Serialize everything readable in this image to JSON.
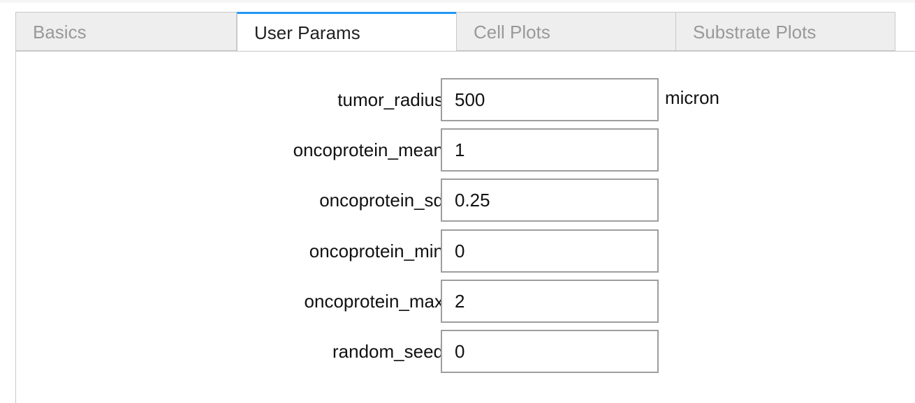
{
  "tabs": [
    {
      "label": "Basics",
      "active": false
    },
    {
      "label": "User Params",
      "active": true
    },
    {
      "label": "Cell Plots",
      "active": false
    },
    {
      "label": "Substrate Plots",
      "active": false
    }
  ],
  "accent_color": "#2196f3",
  "params": [
    {
      "name": "tumor_radius",
      "value": "500",
      "unit": "micron"
    },
    {
      "name": "oncoprotein_mean",
      "value": "1",
      "unit": ""
    },
    {
      "name": "oncoprotein_sd",
      "value": "0.25",
      "unit": ""
    },
    {
      "name": "oncoprotein_min",
      "value": "0",
      "unit": ""
    },
    {
      "name": "oncoprotein_max",
      "value": "2",
      "unit": ""
    },
    {
      "name": "random_seed",
      "value": "0",
      "unit": ""
    }
  ]
}
